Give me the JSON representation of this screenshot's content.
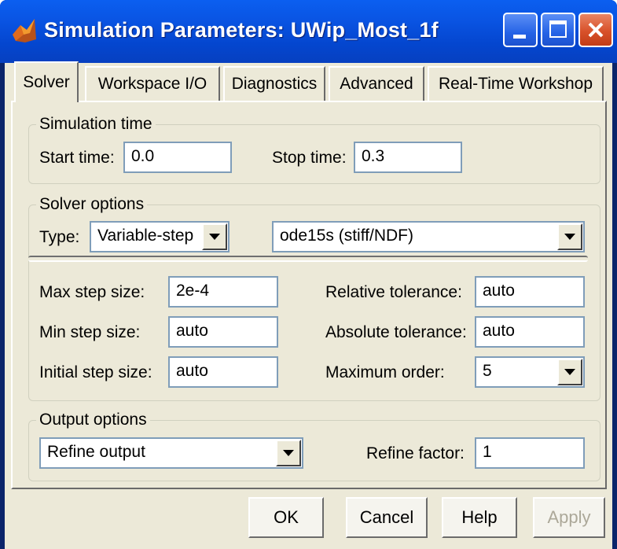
{
  "window": {
    "title": "Simulation Parameters: UWip_Most_1f"
  },
  "tabs": [
    {
      "label": "Solver",
      "active": true
    },
    {
      "label": "Workspace I/O",
      "active": false
    },
    {
      "label": "Diagnostics",
      "active": false
    },
    {
      "label": "Advanced",
      "active": false
    },
    {
      "label": "Real-Time Workshop",
      "active": false
    }
  ],
  "simulation_time": {
    "legend": "Simulation time",
    "start_label": "Start time:",
    "start_value": "0.0",
    "stop_label": "Stop time:",
    "stop_value": "0.3"
  },
  "solver_options": {
    "legend": "Solver options",
    "type_label": "Type:",
    "type_value": "Variable-step",
    "solver_value": "ode15s (stiff/NDF)",
    "max_step_label": "Max step size:",
    "max_step_value": "2e-4",
    "min_step_label": "Min step size:",
    "min_step_value": "auto",
    "initial_step_label": "Initial step size:",
    "initial_step_value": "auto",
    "rel_tol_label": "Relative tolerance:",
    "rel_tol_value": "auto",
    "abs_tol_label": "Absolute tolerance:",
    "abs_tol_value": "auto",
    "max_order_label": "Maximum order:",
    "max_order_value": "5"
  },
  "output_options": {
    "legend": "Output options",
    "output_value": "Refine output",
    "refine_label": "Refine factor:",
    "refine_value": "1"
  },
  "buttons": {
    "ok": "OK",
    "cancel": "Cancel",
    "help": "Help",
    "apply": "Apply"
  },
  "icons": {
    "app": "matlab-simulink-icon",
    "minimize": "minimize-icon",
    "maximize": "maximize-icon",
    "close": "close-icon",
    "dropdown": "chevron-down-icon"
  },
  "colors": {
    "titlebar": "#0a55e4",
    "close_button": "#d8512a",
    "dialog_background": "#ece9d8"
  }
}
